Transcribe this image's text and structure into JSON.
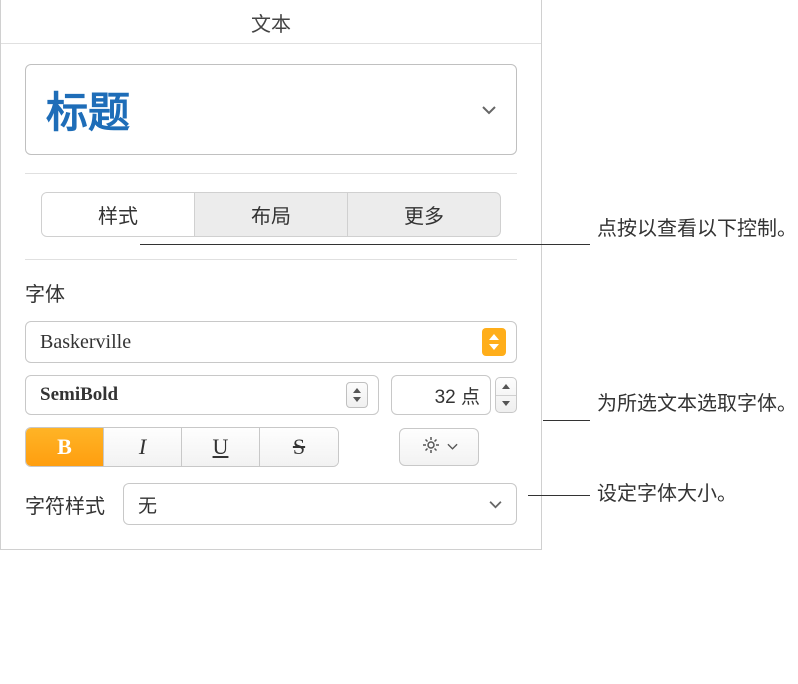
{
  "header": "文本",
  "paragraph_style": "标题",
  "tabs": {
    "style": "样式",
    "layout": "布局",
    "more": "更多"
  },
  "font": {
    "section_label": "字体",
    "family": "Baskerville",
    "weight": "SemiBold",
    "size": "32 点"
  },
  "format": {
    "bold": "B",
    "italic": "I",
    "underline": "U",
    "strike": "S"
  },
  "character_style": {
    "label": "字符样式",
    "value": "无"
  },
  "callouts": {
    "tabs": "点按以查看以下控制。",
    "font": "为所选文本选取字体。",
    "size": "设定字体大小。"
  }
}
